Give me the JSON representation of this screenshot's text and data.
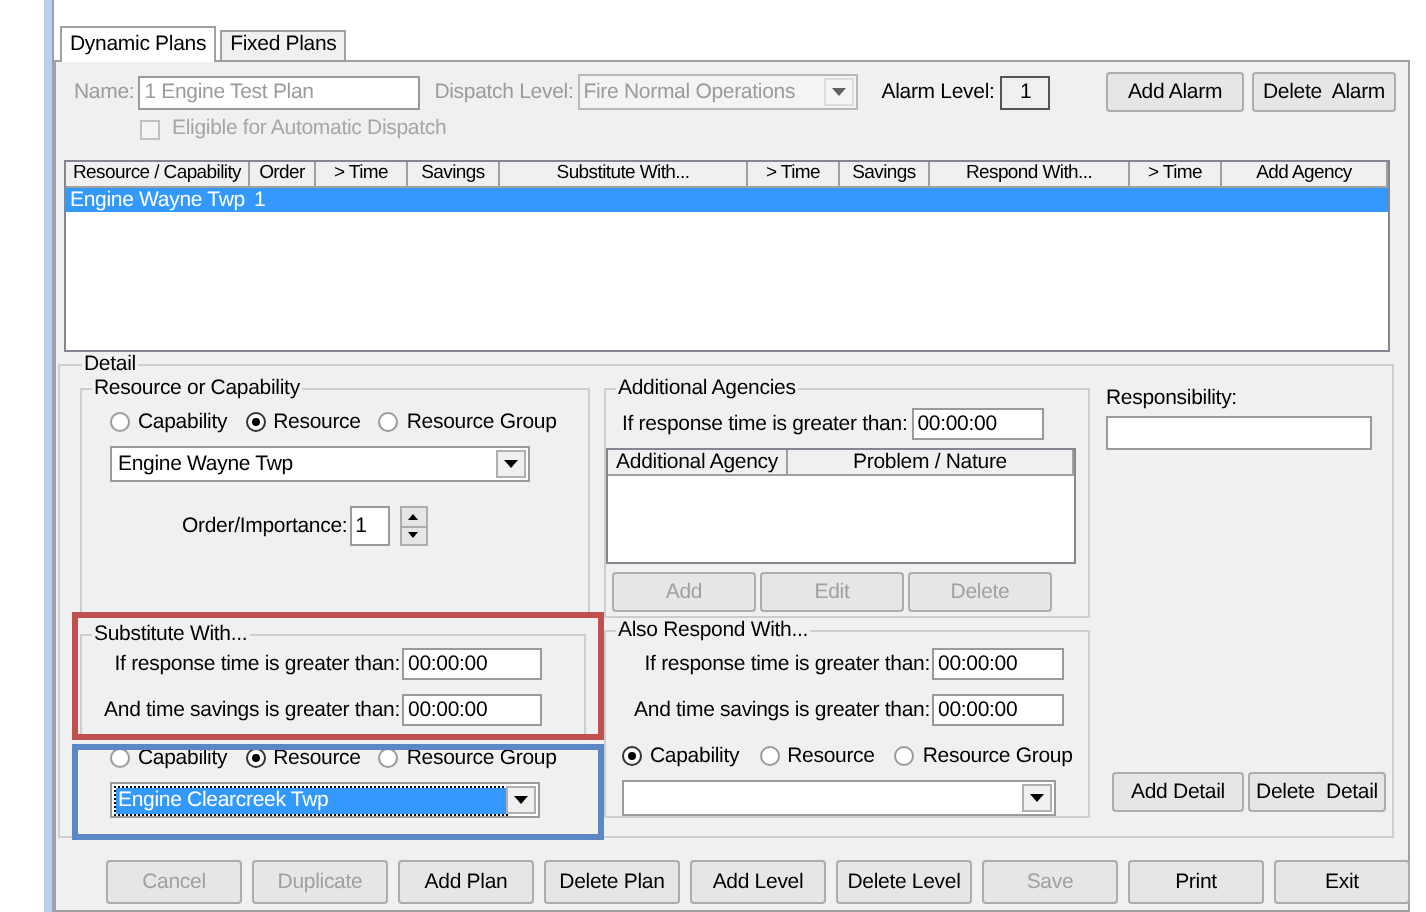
{
  "tabs": [
    {
      "label": "Dynamic Plans",
      "selected": true
    },
    {
      "label": "Fixed Plans",
      "selected": false
    }
  ],
  "plan": {
    "name_label": "Name:",
    "name": "1 Engine Test Plan",
    "dispatch_level_label": "Dispatch Level:",
    "dispatch_level": "Fire Normal Operations",
    "alarm_level_label": "Alarm Level:",
    "alarm_level": "1",
    "disabled": true
  },
  "alarm_buttons": [
    "Add Alarm",
    "Delete  Alarm"
  ],
  "auto_dispatch": {
    "label": "Eligible for Automatic Dispatch",
    "checked": false,
    "disabled": true
  },
  "table": {
    "columns": [
      "Resource / Capability",
      "Order",
      "> Time",
      "Savings",
      "Substitute With...",
      "> Time",
      "Savings",
      "Respond With...",
      "> Time",
      "Add Agency"
    ],
    "rows": [
      {
        "cells": [
          "Engine Wayne Twp",
          "1"
        ],
        "selected": true
      }
    ]
  },
  "detail": {
    "title": "Detail",
    "resource": {
      "title": "Resource or Capability",
      "options": [
        {
          "label": "Capability",
          "selected": false
        },
        {
          "label": "Resource",
          "selected": true
        },
        {
          "label": "Resource Group",
          "selected": false
        }
      ],
      "value": "Engine Wayne Twp",
      "order_label": "Order/Importance:",
      "order": "1"
    },
    "substitute": {
      "title": "Substitute With...",
      "response_label": "If response time is greater than:",
      "response": "00:00:00",
      "savings_label": "And time savings is greater than:",
      "savings": "00:00:00",
      "options": [
        {
          "label": "Capability",
          "selected": false
        },
        {
          "label": "Resource",
          "selected": true
        },
        {
          "label": "Resource Group",
          "selected": false
        }
      ],
      "value": "Engine Clearcreek Twp",
      "value_selected": true
    },
    "additional_agencies": {
      "title": "Additional Agencies",
      "response_label": "If response time is greater than:",
      "response": "00:00:00",
      "columns": [
        "Additional Agency",
        "Problem / Nature"
      ],
      "buttons": [
        {
          "label": "Add",
          "disabled": true
        },
        {
          "label": "Edit",
          "disabled": true
        },
        {
          "label": "Delete",
          "disabled": true
        }
      ]
    },
    "also_respond": {
      "title": "Also Respond With...",
      "response_label": "If response time is greater than:",
      "response": "00:00:00",
      "savings_label": "And time savings is greater than:",
      "savings": "00:00:00",
      "options": [
        {
          "label": "Capability",
          "selected": true
        },
        {
          "label": "Resource",
          "selected": false
        },
        {
          "label": "Resource Group",
          "selected": false
        }
      ]
    },
    "responsibility_label": "Responsibility:",
    "buttons": [
      "Add Detail",
      "Delete  Detail"
    ]
  },
  "buttons": [
    {
      "label": "Cancel",
      "disabled": true
    },
    {
      "label": "Duplicate",
      "disabled": true
    },
    {
      "label": "Add Plan",
      "disabled": false
    },
    {
      "label": "Delete Plan",
      "disabled": false
    },
    {
      "label": "Add Level",
      "disabled": false
    },
    {
      "label": "Delete Level",
      "disabled": false
    },
    {
      "label": "Save",
      "disabled": true
    },
    {
      "label": "Print",
      "disabled": false
    },
    {
      "label": "Exit",
      "disabled": false
    }
  ],
  "highlights": [
    {
      "color": "#c0504d"
    },
    {
      "color": "#5b87c4"
    }
  ]
}
